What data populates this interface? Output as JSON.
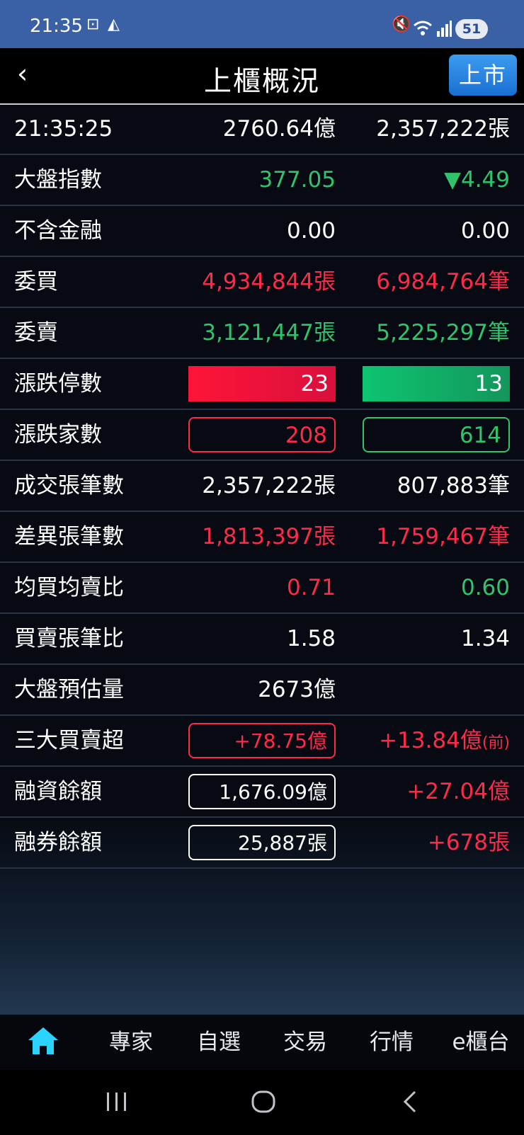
{
  "status": {
    "time": "21:35",
    "battery": "51"
  },
  "header": {
    "title": "上櫃概況",
    "back": "‹",
    "switch_label": "上市"
  },
  "summary": {
    "time": "21:35:25",
    "amount": "2760.64億",
    "volume": "2,357,222張"
  },
  "rows": [
    {
      "label": "大盤指數",
      "c1": "377.05",
      "c2": "▼4.49"
    },
    {
      "label": "不含金融",
      "c1": "0.00",
      "c2": "0.00"
    },
    {
      "label": "委買",
      "c1": "4,934,844張",
      "c2": "6,984,764筆"
    },
    {
      "label": "委賣",
      "c1": "3,121,447張",
      "c2": "5,225,297筆"
    },
    {
      "label": "漲跌停數",
      "c1": "23",
      "c2": "13"
    },
    {
      "label": "漲跌家數",
      "c1": "208",
      "c2": "614"
    },
    {
      "label": "成交張筆數",
      "c1": "2,357,222張",
      "c2": "807,883筆"
    },
    {
      "label": "差異張筆數",
      "c1": "1,813,397張",
      "c2": "1,759,467筆"
    },
    {
      "label": "均買均賣比",
      "c1": "0.71",
      "c2": "0.60"
    },
    {
      "label": "買賣張筆比",
      "c1": "1.58",
      "c2": "1.34"
    },
    {
      "label": "大盤預估量",
      "c1": "2673億",
      "c2": ""
    },
    {
      "label": "三大買賣超",
      "c1": "+78.75億",
      "c2": "+13.84億",
      "c2_suffix": "(前)"
    },
    {
      "label": "融資餘額",
      "c1": "1,676.09億",
      "c2": "+27.04億"
    },
    {
      "label": "融券餘額",
      "c1": "25,887張",
      "c2": "+678張"
    }
  ],
  "tabs": [
    "專家",
    "自選",
    "交易",
    "行情",
    "e櫃台"
  ],
  "colors": {
    "up": "#ff2a4a",
    "down": "#2fc46b",
    "accent": "#2ad4ff",
    "header": "#3a61a6"
  }
}
